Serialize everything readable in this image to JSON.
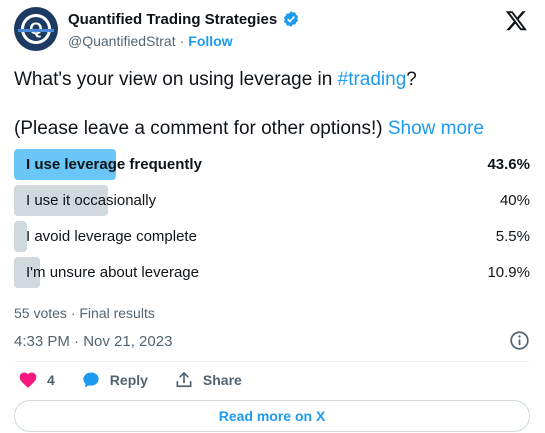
{
  "header": {
    "display_name": "Quantified Trading Strategies",
    "handle": "@QuantifiedStrat",
    "separator": "·",
    "follow_label": "Follow"
  },
  "tweet": {
    "question_prefix": "What's your view on using leverage in ",
    "hashtag": "#trading",
    "question_suffix": "?",
    "note": "(Please leave a comment for other options!)",
    "show_more": "Show more"
  },
  "poll": {
    "options": [
      {
        "label": "I use leverage frequently",
        "percent": "43.6%",
        "value": 43.6,
        "leading": true
      },
      {
        "label": "I use it occasionally",
        "percent": "40%",
        "value": 40,
        "leading": false
      },
      {
        "label": "I avoid leverage complete",
        "percent": "5.5%",
        "value": 5.5,
        "leading": false
      },
      {
        "label": "I'm unsure about leverage",
        "percent": "10.9%",
        "value": 10.9,
        "leading": false
      }
    ],
    "votes_summary": "55 votes · Final results"
  },
  "meta": {
    "timestamp": "4:33 PM · Nov 21, 2023"
  },
  "actions": {
    "like_count": "4",
    "reply_label": "Reply",
    "share_label": "Share"
  },
  "read_more_label": "Read more on X",
  "colors": {
    "accent": "#1d9bf0",
    "leading_fill": "#6ac6f7",
    "other_fill": "#cfd9de",
    "like": "#f91880"
  },
  "icons": [
    "avatar-logo",
    "verified-badge-icon",
    "x-logo-icon",
    "info-icon",
    "heart-icon",
    "reply-bubble-icon",
    "share-icon"
  ]
}
